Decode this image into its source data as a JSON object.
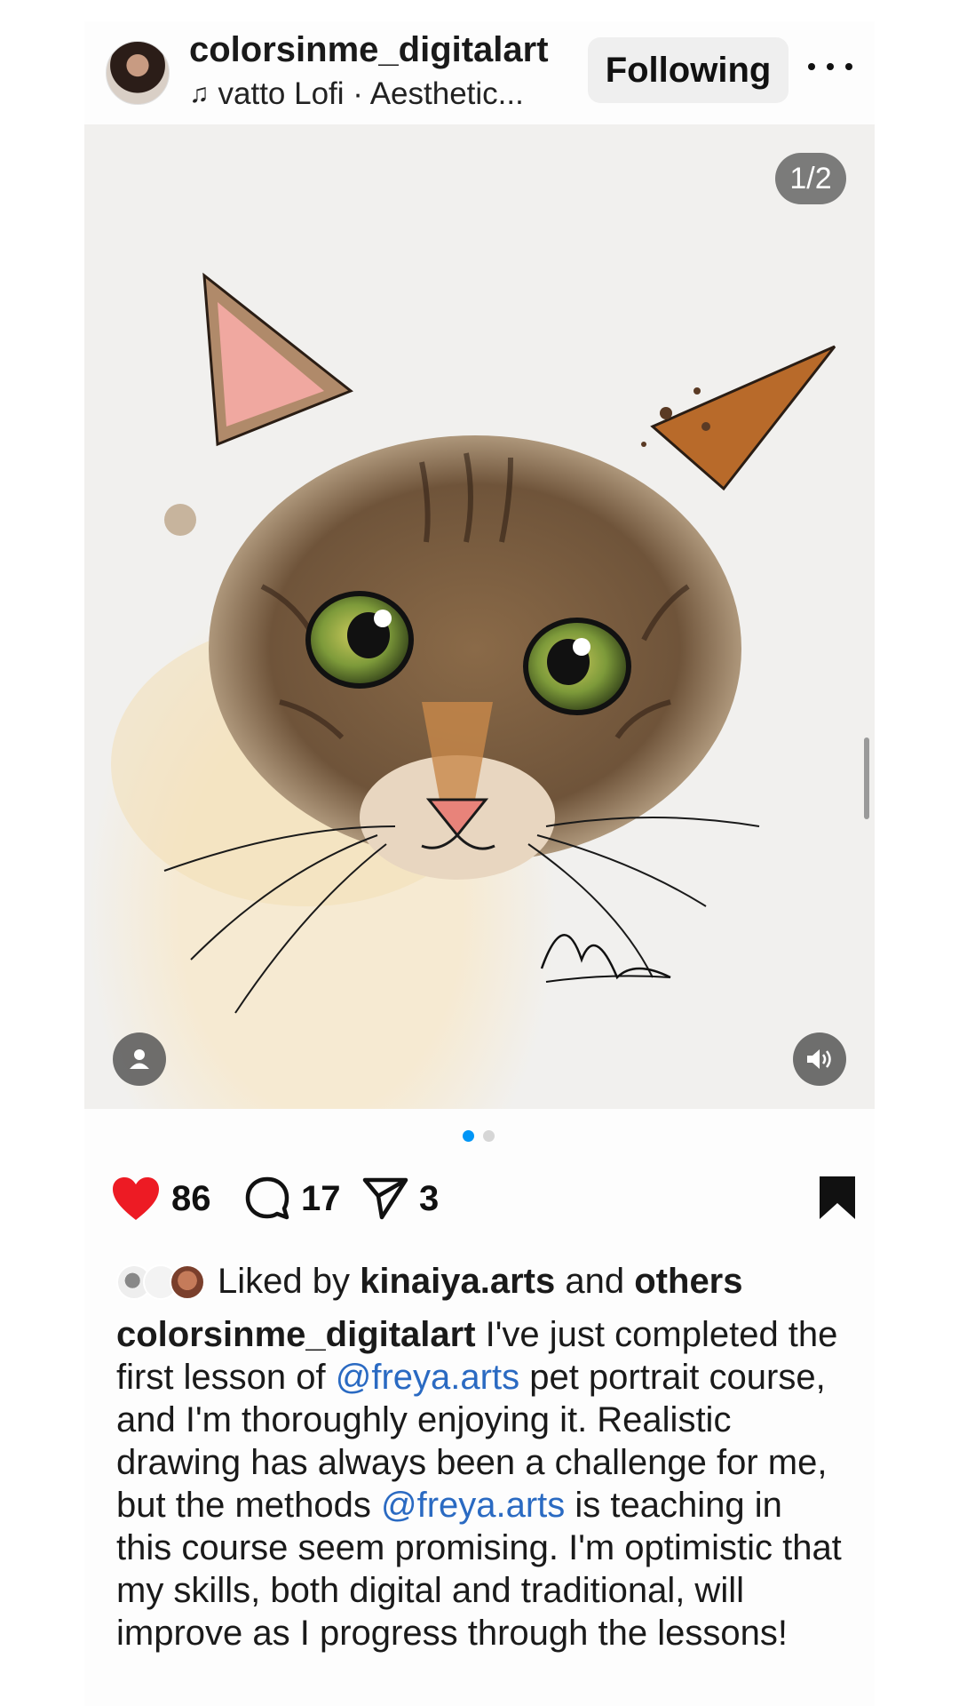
{
  "header": {
    "username": "colorsinme_digitalart",
    "music": "vatto Lofi · Aesthetic...",
    "follow_label": "Following"
  },
  "media": {
    "counter": "1/2",
    "slides_total": 2,
    "active_slide": 1
  },
  "actions": {
    "likes": "86",
    "comments": "17",
    "shares": "3",
    "liked": true,
    "saved": true
  },
  "liked_by": {
    "prefix": "Liked by",
    "user": "kinaiya.arts",
    "and": "and",
    "others": "others"
  },
  "caption": {
    "username": "colorsinme_digitalart",
    "part1": " I've just completed the first lesson of ",
    "mention1": "@freya.arts",
    "part2": " pet portrait course, and I'm thoroughly enjoying it. Realistic drawing has always been a challenge for me, but the methods ",
    "mention2": "@freya.arts",
    "part3": " is teaching in this course seem promising. I'm optimistic that my skills, both digital and traditional, will improve as I progress through the lessons!"
  },
  "colors": {
    "accent": "#0095f6",
    "like": "#ed1b24",
    "mention": "#2a6ac2"
  },
  "icons": {
    "like": "heart-icon",
    "comment": "comment-icon",
    "share": "send-icon",
    "save": "bookmark-icon",
    "more": "more-dots-icon",
    "music": "music-note-icon",
    "user_tag": "person-icon",
    "audio": "speaker-icon"
  }
}
